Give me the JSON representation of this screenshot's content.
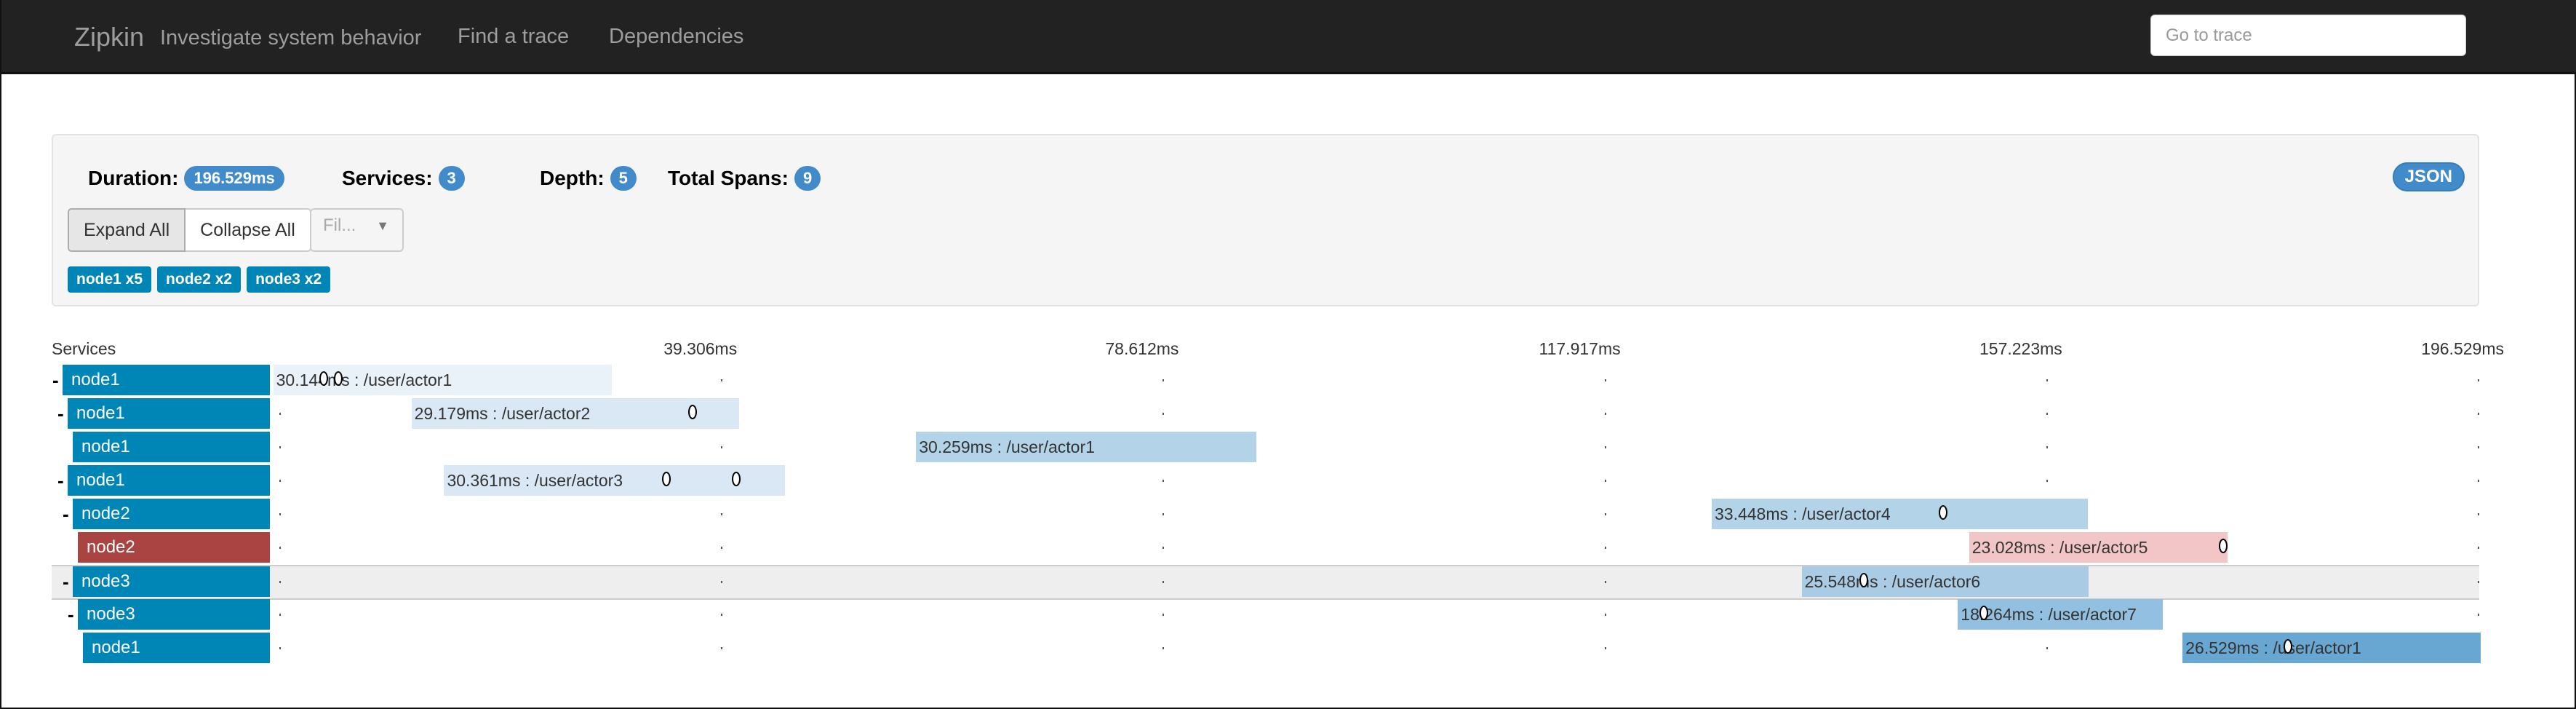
{
  "nav": {
    "brand": "Zipkin",
    "tagline": "Investigate system behavior",
    "links": [
      "Find a trace",
      "Dependencies"
    ],
    "goto_placeholder": "Go to trace"
  },
  "summary": {
    "duration_label": "Duration:",
    "duration": "196.529ms",
    "services_label": "Services:",
    "services": "3",
    "depth_label": "Depth:",
    "depth": "5",
    "total_spans_label": "Total Spans:",
    "total_spans": "9",
    "json_label": "JSON",
    "expand_all": "Expand All",
    "collapse_all": "Collapse All",
    "filter_placeholder": "Fil...",
    "service_tags": [
      "node1 x5",
      "node2 x2",
      "node3 x2"
    ]
  },
  "timeline": {
    "services_header": "Services",
    "total_ms": 196.529,
    "ticks": [
      "39.306ms",
      "78.612ms",
      "117.917ms",
      "157.223ms",
      "196.529ms"
    ],
    "highlighted_row": 6,
    "spans": [
      {
        "service": "node1",
        "depth": 0,
        "toggle": "-",
        "start_ms": 0.3,
        "duration_ms": 30.144,
        "label": "30.144ms : /user/actor1",
        "color": "#eaf2f9",
        "error": false,
        "annotations_ms": [
          4.8,
          6.1
        ]
      },
      {
        "service": "node1",
        "depth": 1,
        "toggle": "-",
        "start_ms": 12.6,
        "duration_ms": 29.179,
        "label": "29.179ms : /user/actor2",
        "color": "#d9e8f4",
        "error": false,
        "annotations_ms": [
          37.6
        ]
      },
      {
        "service": "node1",
        "depth": 2,
        "toggle": "",
        "start_ms": 57.5,
        "duration_ms": 30.259,
        "label": "30.259ms : /user/actor1",
        "color": "#b3d3e8",
        "error": false,
        "annotations_ms": []
      },
      {
        "service": "node1",
        "depth": 1,
        "toggle": "-",
        "start_ms": 15.5,
        "duration_ms": 30.361,
        "label": "30.361ms : /user/actor3",
        "color": "#d9e8f4",
        "error": false,
        "annotations_ms": [
          35.3,
          41.5
        ]
      },
      {
        "service": "node2",
        "depth": 2,
        "toggle": "-",
        "start_ms": 128.3,
        "duration_ms": 33.448,
        "label": "33.448ms : /user/actor4",
        "color": "#b3d3e8",
        "error": false,
        "annotations_ms": [
          148.9
        ]
      },
      {
        "service": "node2",
        "depth": 3,
        "toggle": "",
        "start_ms": 151.2,
        "duration_ms": 23.028,
        "label": "23.028ms : /user/actor5",
        "color": "#f2c6c6",
        "error": true,
        "annotations_ms": [
          173.8
        ]
      },
      {
        "service": "node3",
        "depth": 2,
        "toggle": "-",
        "start_ms": 136.3,
        "duration_ms": 25.548,
        "label": "25.548ms : /user/actor6",
        "color": "#a9cbe3",
        "error": false,
        "annotations_ms": [
          141.8
        ]
      },
      {
        "service": "node3",
        "depth": 3,
        "toggle": "-",
        "start_ms": 150.2,
        "duration_ms": 18.264,
        "label": "18.264ms : /user/actor7",
        "color": "#92c0e0",
        "error": false,
        "annotations_ms": [
          152.5
        ]
      },
      {
        "service": "node1",
        "depth": 4,
        "toggle": "",
        "start_ms": 170.2,
        "duration_ms": 26.529,
        "label": "26.529ms : /user/actor1",
        "color": "#68a7d2",
        "error": false,
        "annotations_ms": [
          179.6
        ]
      }
    ]
  }
}
